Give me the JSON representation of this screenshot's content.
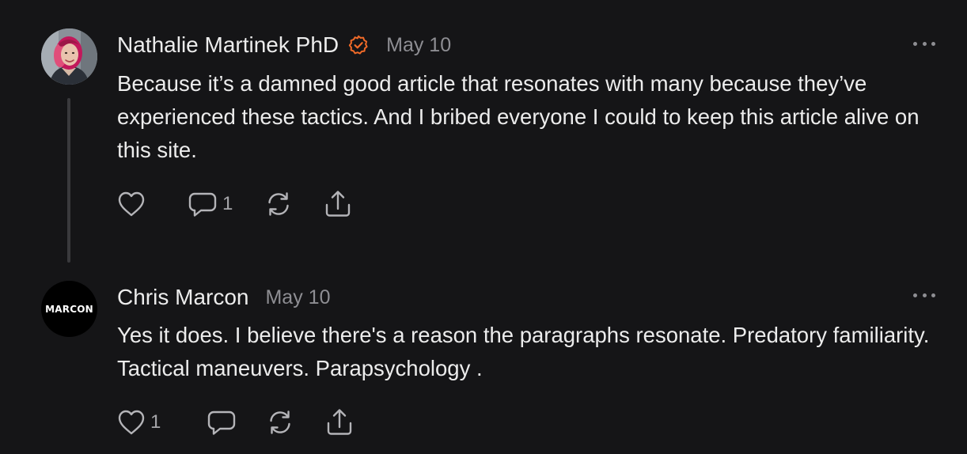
{
  "comments": [
    {
      "author": "Nathalie Martinek PhD",
      "verified": true,
      "date": "May 10",
      "text": "Because it’s a damned good article that resonates with many because they’ve experienced these tactics. And I bribed everyone I could to keep this article alive on this site.",
      "likes": "",
      "replies": "1",
      "avatar": "profile-photo"
    },
    {
      "author": "Chris Marcon",
      "verified": false,
      "date": "May 10",
      "text": "Yes it does. I believe there's a reason the paragraphs resonate. Predatory familiarity. Tactical maneuvers. Parapsychology .",
      "likes": "1",
      "replies": "",
      "avatar_label": "MARCON"
    }
  ],
  "colors": {
    "background": "#151517",
    "text": "#ececec",
    "muted": "#8e8e93",
    "verified_badge": "#f06a28",
    "thread_line": "#3a3a3d"
  },
  "icons": {
    "like": "heart-icon",
    "reply": "comment-bubble-icon",
    "restack": "restack-icon",
    "share": "share-icon",
    "more": "more-options-icon",
    "verified": "verified-badge-icon"
  }
}
